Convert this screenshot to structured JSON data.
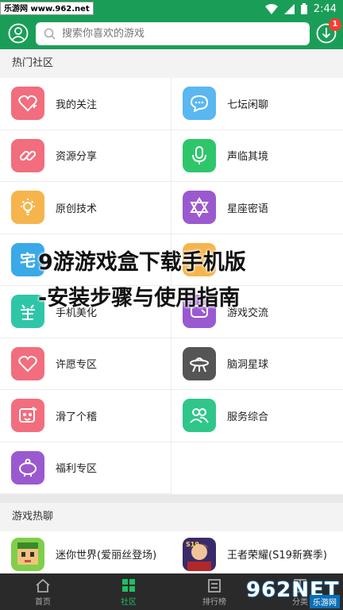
{
  "status_bar": {
    "watermark": "乐游网 www.962.net",
    "time": "2:44"
  },
  "header": {
    "search_placeholder": "搜索你喜欢的游戏",
    "badge": "1"
  },
  "section_hot": "热门社区",
  "community": [
    {
      "label": "我的关注",
      "icon": "heart-plus-icon",
      "color": "#f26d7d"
    },
    {
      "label": "七坛闲聊",
      "icon": "chat-bubble-icon",
      "color": "#5ab7f0"
    },
    {
      "label": "资源分享",
      "icon": "link-icon",
      "color": "#f26d7d"
    },
    {
      "label": "声临其境",
      "icon": "microphone-icon",
      "color": "#2fc66b"
    },
    {
      "label": "原创技术",
      "icon": "lightbulb-icon",
      "color": "#f6b54c"
    },
    {
      "label": "星座密语",
      "icon": "star-of-david-icon",
      "color": "#9b59d0"
    },
    {
      "label": "宅",
      "icon": "otaku-icon",
      "color": "#3aa9e8"
    },
    {
      "label": "",
      "icon": "game-icon",
      "color": "#f6b54c"
    },
    {
      "label": "手机美化",
      "icon": "beautify-icon",
      "color": "#2fc6a8"
    },
    {
      "label": "游戏交流",
      "icon": "gamepad-icon",
      "color": "#9b59d0"
    },
    {
      "label": "许愿专区",
      "icon": "heart-outline-icon",
      "color": "#f26d7d"
    },
    {
      "label": "脑洞星球",
      "icon": "ufo-icon",
      "color": "#555555"
    },
    {
      "label": "滑了个稽",
      "icon": "funny-face-icon",
      "color": "#f26d7d"
    },
    {
      "label": "服务综合",
      "icon": "service-people-icon",
      "color": "#2fc68a"
    },
    {
      "label": "福利专区",
      "icon": "piggy-bank-icon",
      "color": "#9b59d0"
    }
  ],
  "section_games": "游戏热聊",
  "games": [
    {
      "label": "迷你世界(爱丽丝登场)",
      "icon": "mini-world-icon"
    },
    {
      "label": "王者荣耀(S19新赛季)",
      "icon": "honor-of-kings-icon"
    }
  ],
  "tabs": [
    {
      "label": "首页",
      "icon": "home-icon",
      "active": false
    },
    {
      "label": "社区",
      "icon": "grid-icon",
      "active": true
    },
    {
      "label": "排行榜",
      "icon": "ranking-icon",
      "active": false
    },
    {
      "label": "分类",
      "icon": "category-icon",
      "active": false
    }
  ],
  "overlay": {
    "line1": "9游游戏盒下载手机版",
    "line2": "-安装步骤与使用指南"
  },
  "watermark_br": {
    "logo": "962NET",
    "sub": "乐游网"
  }
}
